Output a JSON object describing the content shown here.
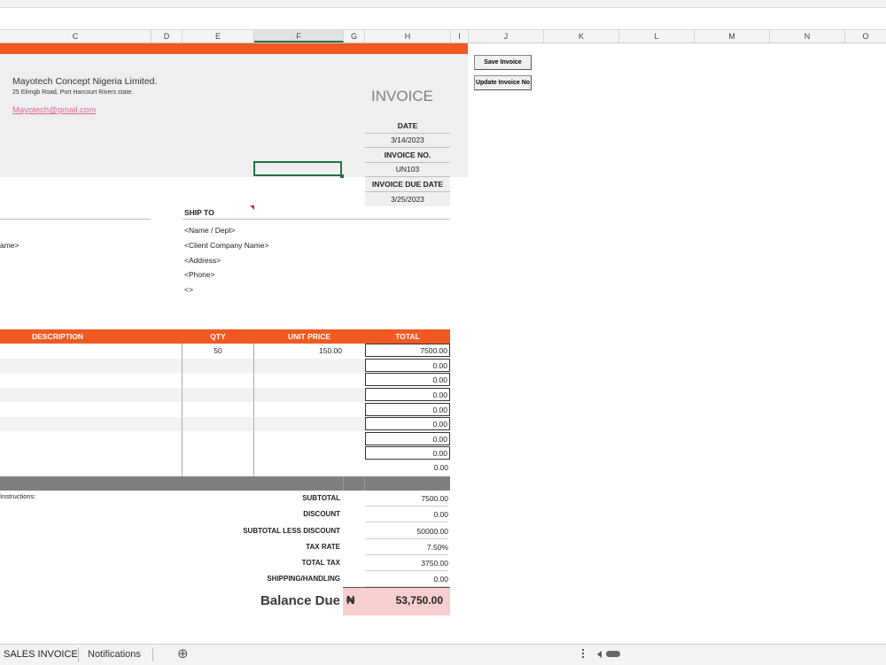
{
  "columns": [
    "C",
    "D",
    "E",
    "F",
    "G",
    "H",
    "I",
    "J",
    "K",
    "L",
    "M",
    "N",
    "O"
  ],
  "buttons": {
    "save": "Save Invoice",
    "update": "Update Invoice No"
  },
  "company": {
    "name": "Mayotech Concept Nigeria Limited.",
    "address": "25 Elimgb Road, Port Harcourt Rivers state.",
    "email": "Mayotech@gmail.com"
  },
  "invoice": {
    "title": "INVOICE",
    "date_label": "DATE",
    "date": "3/14/2023",
    "no_label": "INVOICE NO.",
    "no": "UN103",
    "due_label": "INVOICE DUE DATE",
    "due": "3/25/2023"
  },
  "ship_to": {
    "label": "SHIP TO",
    "lines": [
      "<Name / Dept>",
      "<Client Company Name>",
      "<Address>",
      "<Phone>",
      "<>"
    ]
  },
  "bill_to_partial": "ame>",
  "table": {
    "headers": {
      "desc": "DESCRIPTION",
      "qty": "QTY",
      "price": "UNIT PRICE",
      "total": "TOTAL"
    },
    "rows": [
      {
        "qty": "50",
        "price": "150.00",
        "total": "7500.00"
      },
      {
        "qty": "",
        "price": "",
        "total": "0.00"
      },
      {
        "qty": "",
        "price": "",
        "total": "0.00"
      },
      {
        "qty": "",
        "price": "",
        "total": "0.00"
      },
      {
        "qty": "",
        "price": "",
        "total": "0.00"
      },
      {
        "qty": "",
        "price": "",
        "total": "0.00"
      },
      {
        "qty": "",
        "price": "",
        "total": "0.00"
      },
      {
        "qty": "",
        "price": "",
        "total": "0.00"
      },
      {
        "qty": "",
        "price": "",
        "total": "0.00"
      }
    ]
  },
  "instructions_partial": "Instructions:",
  "summary": {
    "subtotal_label": "SUBTOTAL",
    "subtotal": "7500.00",
    "discount_label": "DISCOUNT",
    "discount": "0.00",
    "less_label": "SUBTOTAL LESS DISCOUNT",
    "less": "50000.00",
    "taxrate_label": "TAX RATE",
    "taxrate": "7.50%",
    "totaltax_label": "TOTAL TAX",
    "totaltax": "3750.00",
    "shipping_label": "SHIPPING/HANDLING",
    "shipping": "0.00",
    "balance_label": "Balance Due",
    "currency": "₦",
    "balance": "53,750.00"
  },
  "sheet_tabs": {
    "active": "SALES INVOICE",
    "other": "Notifications",
    "add": "⊕"
  },
  "colors": {
    "accent": "#f05a22",
    "grid_header": "#7f7f7f",
    "balance_bg": "#f7cfcf",
    "selected": "#217346"
  }
}
